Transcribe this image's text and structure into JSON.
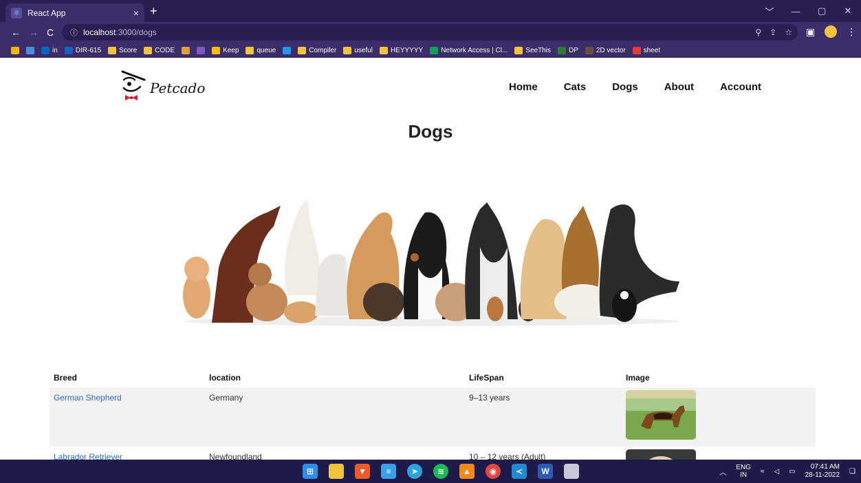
{
  "browser": {
    "tab_title": "React App",
    "tab_close": "×",
    "new_tab": "+",
    "url_host": "localhost",
    "url_path": ":3000/dogs",
    "window_controls": [
      "﹀",
      "—",
      "▢",
      "✕"
    ],
    "bookmarks": [
      {
        "label": "",
        "color": "#f4b400"
      },
      {
        "label": "",
        "color": "#4a90d9"
      },
      {
        "label": "in",
        "color": "#0a66c2"
      },
      {
        "label": "DIR-615",
        "color": "#1565c0"
      },
      {
        "label": "Score",
        "color": "#f5c43a"
      },
      {
        "label": "CODE",
        "color": "#f5c43a"
      },
      {
        "label": "",
        "color": "#e39d3a"
      },
      {
        "label": "",
        "color": "#7e57c2"
      },
      {
        "label": "Keep",
        "color": "#fbbc04"
      },
      {
        "label": "queue",
        "color": "#f5c43a"
      },
      {
        "label": "",
        "color": "#2196f3"
      },
      {
        "label": "Compiler",
        "color": "#f5c43a"
      },
      {
        "label": "useful",
        "color": "#f5c43a"
      },
      {
        "label": "HEYYYYY",
        "color": "#f5c43a"
      },
      {
        "label": "Network Access | Cl...",
        "color": "#0f9d58"
      },
      {
        "label": "SeeThis",
        "color": "#f5c43a"
      },
      {
        "label": "DP",
        "color": "#2e7d32"
      },
      {
        "label": "2D vector",
        "color": "#6d4c41"
      },
      {
        "label": "sheet",
        "color": "#e53935"
      }
    ]
  },
  "site": {
    "brand": "Petcado",
    "nav": [
      "Home",
      "Cats",
      "Dogs",
      "About",
      "Account"
    ],
    "page_title": "Dogs"
  },
  "table": {
    "headers": [
      "Breed",
      "location",
      "LifeSpan",
      "Image"
    ],
    "rows": [
      {
        "breed": "German Shepherd",
        "location": "Germany",
        "lifespan": "9–13 years"
      },
      {
        "breed": "Labrador Retriever",
        "location": "Newfoundland",
        "lifespan": "10 – 12 years (Adult)"
      }
    ]
  },
  "taskbar": {
    "lang_top": "ENG",
    "lang_bottom": "IN",
    "time": "07:41 AM",
    "date": "28-11-2022"
  }
}
